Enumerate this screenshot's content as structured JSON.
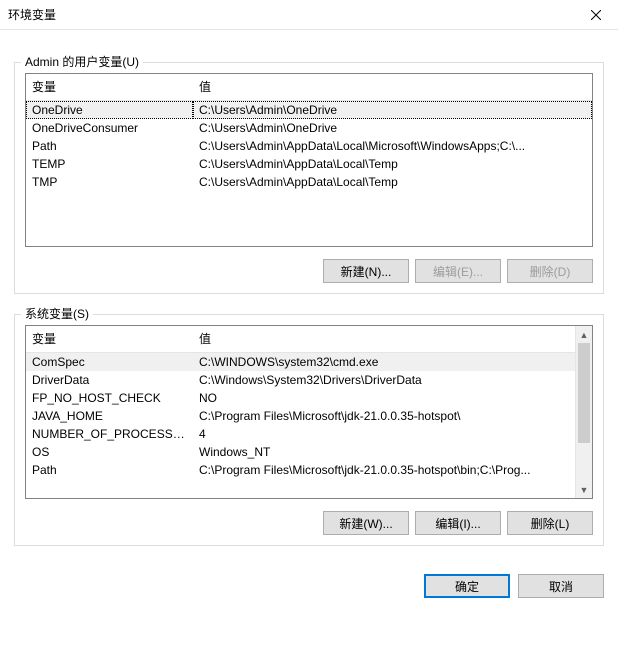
{
  "window": {
    "title": "环境变量"
  },
  "user_section": {
    "label": "Admin 的用户变量(U)",
    "headers": {
      "name": "变量",
      "value": "值"
    },
    "rows": [
      {
        "name": "OneDrive",
        "value": "C:\\Users\\Admin\\OneDrive",
        "selected": true
      },
      {
        "name": "OneDriveConsumer",
        "value": "C:\\Users\\Admin\\OneDrive"
      },
      {
        "name": "Path",
        "value": "C:\\Users\\Admin\\AppData\\Local\\Microsoft\\WindowsApps;C:\\..."
      },
      {
        "name": "TEMP",
        "value": "C:\\Users\\Admin\\AppData\\Local\\Temp"
      },
      {
        "name": "TMP",
        "value": "C:\\Users\\Admin\\AppData\\Local\\Temp"
      }
    ],
    "buttons": {
      "new": "新建(N)...",
      "edit": "编辑(E)...",
      "delete": "删除(D)"
    }
  },
  "system_section": {
    "label": "系统变量(S)",
    "headers": {
      "name": "变量",
      "value": "值"
    },
    "rows": [
      {
        "name": "ComSpec",
        "value": "C:\\WINDOWS\\system32\\cmd.exe",
        "selected": true
      },
      {
        "name": "DriverData",
        "value": "C:\\Windows\\System32\\Drivers\\DriverData"
      },
      {
        "name": "FP_NO_HOST_CHECK",
        "value": "NO"
      },
      {
        "name": "JAVA_HOME",
        "value": "C:\\Program Files\\Microsoft\\jdk-21.0.0.35-hotspot\\"
      },
      {
        "name": "NUMBER_OF_PROCESSORS",
        "value": "4"
      },
      {
        "name": "OS",
        "value": "Windows_NT"
      },
      {
        "name": "Path",
        "value": "C:\\Program Files\\Microsoft\\jdk-21.0.0.35-hotspot\\bin;C:\\Prog..."
      }
    ],
    "buttons": {
      "new": "新建(W)...",
      "edit": "编辑(I)...",
      "delete": "删除(L)"
    }
  },
  "footer": {
    "ok": "确定",
    "cancel": "取消"
  }
}
